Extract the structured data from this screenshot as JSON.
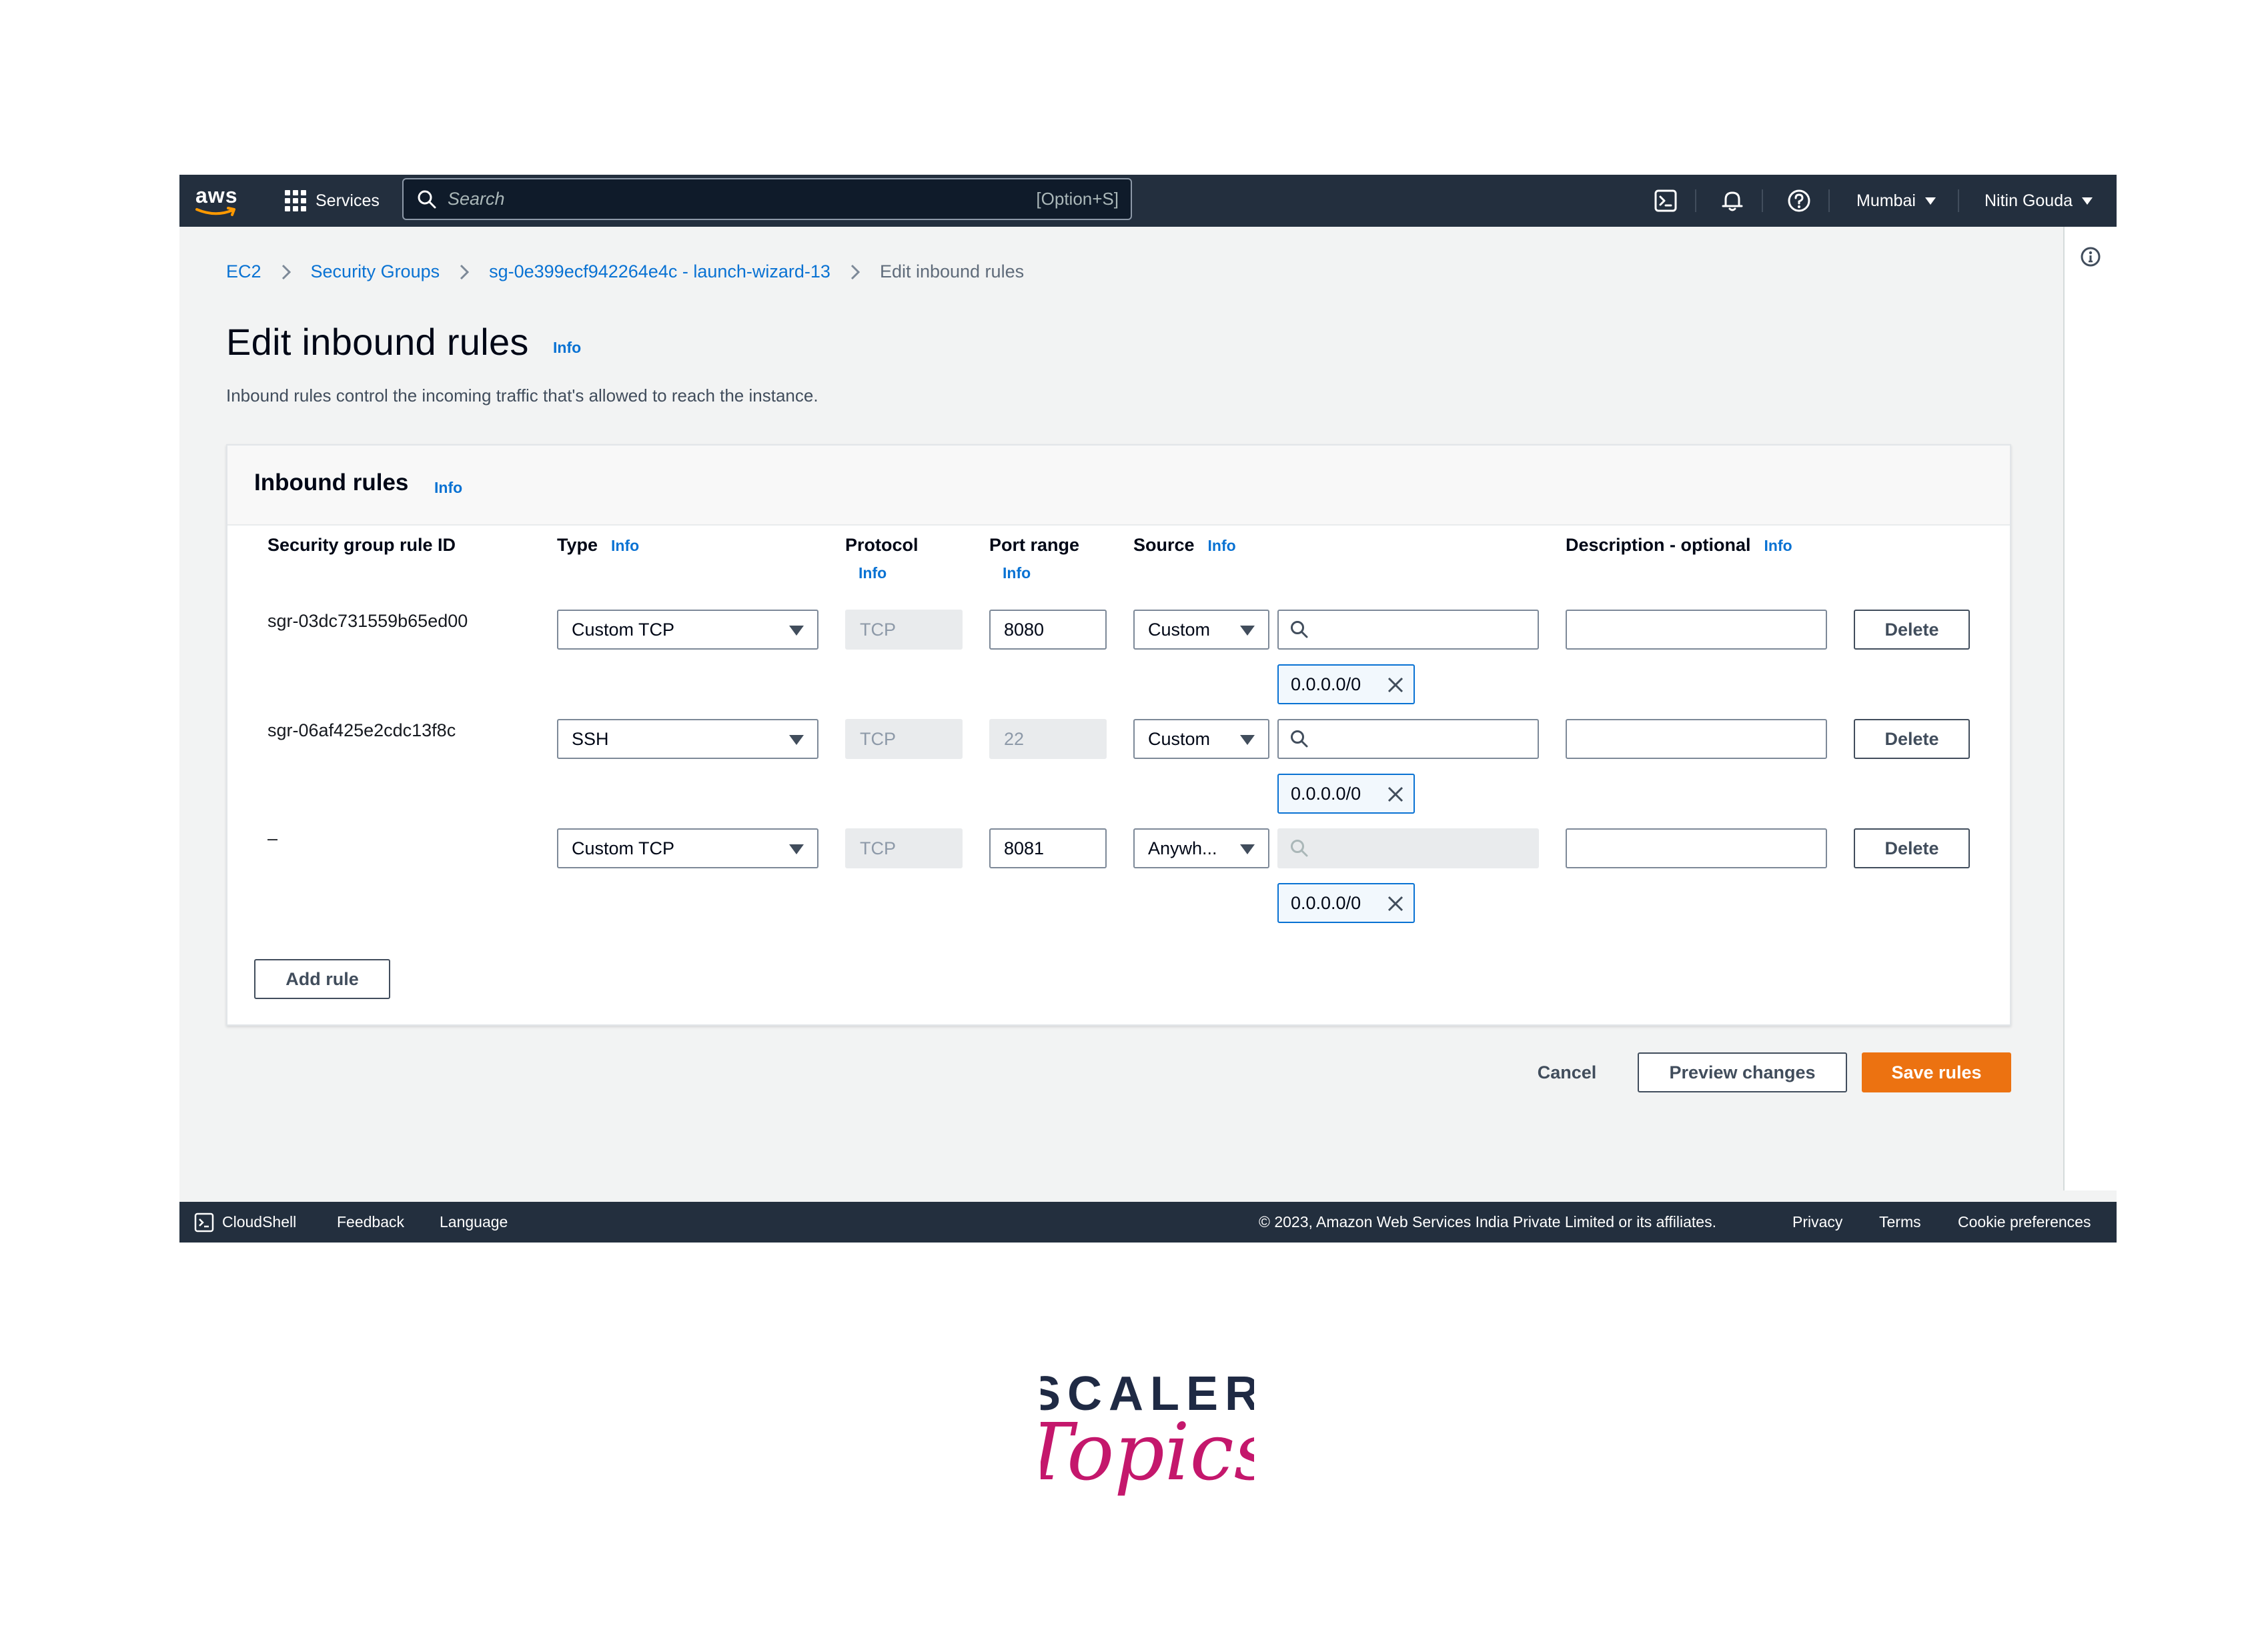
{
  "nav": {
    "logo": "aws",
    "services": "Services",
    "search_placeholder": "Search",
    "search_shortcut": "[Option+S]",
    "region": "Mumbai",
    "user": "Nitin Gouda",
    "icons": [
      "cloudshell-icon",
      "bell-icon",
      "help-icon"
    ]
  },
  "breadcrumb": {
    "items": [
      "EC2",
      "Security Groups",
      "sg-0e399ecf942264e4c - launch-wizard-13"
    ],
    "current": "Edit inbound rules"
  },
  "page": {
    "title": "Edit inbound rules",
    "info": "Info",
    "description": "Inbound rules control the incoming traffic that's allowed to reach the instance."
  },
  "container": {
    "title": "Inbound rules",
    "info": "Info",
    "columns": {
      "rule_id": "Security group rule ID",
      "type": "Type",
      "protocol": "Protocol",
      "port_range": "Port range",
      "source": "Source",
      "description": "Description - optional",
      "info": "Info"
    },
    "rules": [
      {
        "id": "sgr-03dc731559b65ed00",
        "type": "Custom TCP",
        "protocol": "TCP",
        "port": "8080",
        "source": "Custom",
        "cidr": "0.0.0.0/0",
        "delete": "Delete"
      },
      {
        "id": "sgr-06af425e2cdc13f8c",
        "type": "SSH",
        "protocol": "TCP",
        "port": "22",
        "source": "Custom",
        "cidr": "0.0.0.0/0",
        "delete": "Delete"
      },
      {
        "id": "–",
        "type": "Custom TCP",
        "protocol": "TCP",
        "port": "8081",
        "source": "Anywh...",
        "cidr": "0.0.0.0/0",
        "delete": "Delete"
      }
    ],
    "add_rule": "Add rule"
  },
  "actions": {
    "cancel": "Cancel",
    "preview": "Preview changes",
    "save": "Save rules"
  },
  "footer": {
    "cloudshell": "CloudShell",
    "feedback": "Feedback",
    "language": "Language",
    "copyright": "© 2023, Amazon Web Services India Private Limited or its affiliates.",
    "privacy": "Privacy",
    "terms": "Terms",
    "cookies": "Cookie preferences"
  },
  "watermark": {
    "line1": "SCALER",
    "line2": "Topics"
  },
  "colors": {
    "nav_bg": "#232f3e",
    "link": "#0972d3",
    "primary": "#ec7211",
    "page_bg": "#f2f3f3",
    "scaler_dark": "#1f2a44",
    "scaler_pink": "#c4176c"
  }
}
